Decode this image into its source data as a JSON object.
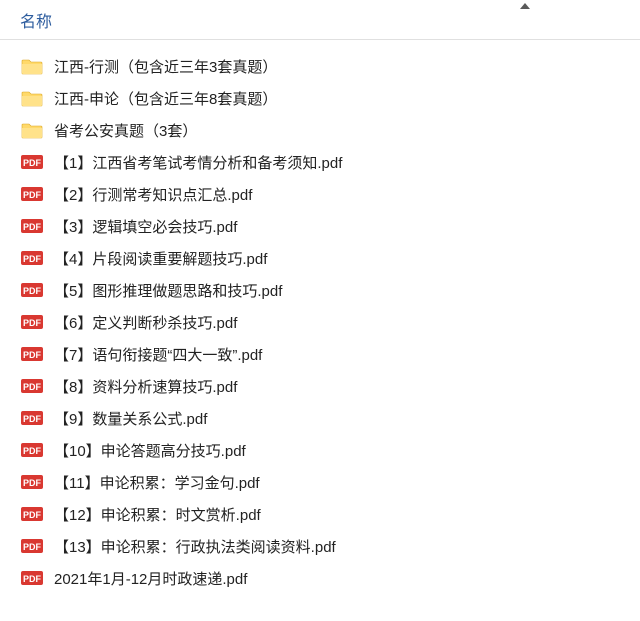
{
  "header": {
    "column_name": "名称"
  },
  "items": [
    {
      "type": "folder",
      "name": "江西-行测（包含近三年3套真题）"
    },
    {
      "type": "folder",
      "name": "江西-申论（包含近三年8套真题）"
    },
    {
      "type": "folder",
      "name": "省考公安真题（3套）"
    },
    {
      "type": "pdf",
      "name": "【1】江西省考笔试考情分析和备考须知.pdf"
    },
    {
      "type": "pdf",
      "name": "【2】行测常考知识点汇总.pdf"
    },
    {
      "type": "pdf",
      "name": "【3】逻辑填空必会技巧.pdf"
    },
    {
      "type": "pdf",
      "name": "【4】片段阅读重要解题技巧.pdf"
    },
    {
      "type": "pdf",
      "name": "【5】图形推理做题思路和技巧.pdf"
    },
    {
      "type": "pdf",
      "name": "【6】定义判断秒杀技巧.pdf"
    },
    {
      "type": "pdf",
      "name": "【7】语句衔接题“四大一致”.pdf"
    },
    {
      "type": "pdf",
      "name": "【8】资料分析速算技巧.pdf"
    },
    {
      "type": "pdf",
      "name": "【9】数量关系公式.pdf"
    },
    {
      "type": "pdf",
      "name": "【10】申论答题高分技巧.pdf"
    },
    {
      "type": "pdf",
      "name": "【11】申论积累：学习金句.pdf"
    },
    {
      "type": "pdf",
      "name": "【12】申论积累：时文赏析.pdf"
    },
    {
      "type": "pdf",
      "name": "【13】申论积累：行政执法类阅读资料.pdf"
    },
    {
      "type": "pdf",
      "name": "2021年1月-12月时政速递.pdf"
    }
  ]
}
